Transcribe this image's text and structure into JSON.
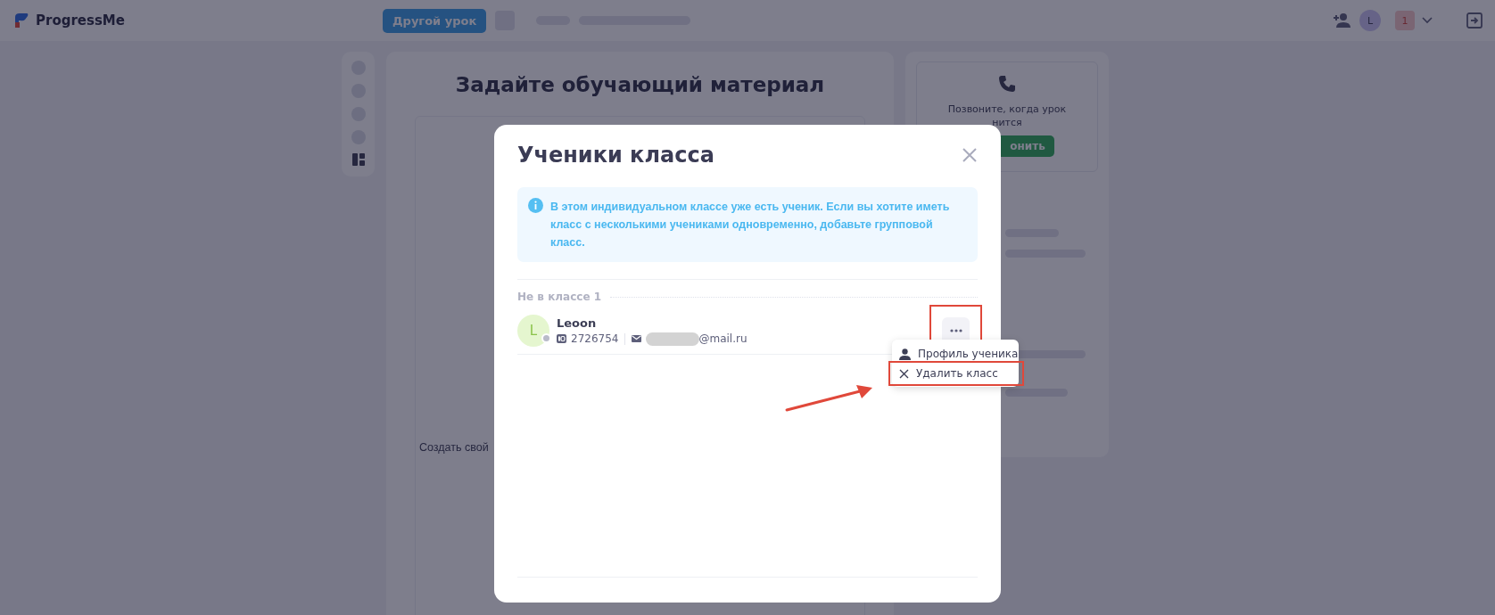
{
  "top_bar": {
    "logo": "ProgressMe",
    "lesson_button": "Другой урок",
    "avatar_initial": "L",
    "notification_count": "1"
  },
  "page": {
    "heading": "Задайте обучающий материал",
    "create_own": "Создать свой",
    "call_card": {
      "text_line_1": "Позвоните, когда урок",
      "text_line_2": "нится",
      "button": "онить"
    }
  },
  "modal": {
    "title": "Ученики класса",
    "info": "В этом индивидуальном классе уже есть ученик. Если вы хотите иметь класс с несколькими учениками одновременно, добавьте групповой класс.",
    "section": "Не в классе 1",
    "students": [
      {
        "initial": "L",
        "name": "Leoon",
        "id": "2726754",
        "email_visible": "@mail.ru",
        "menu_highlighted": true
      }
    ],
    "menu": [
      {
        "label": "Профиль ученика",
        "kind": "profile",
        "highlighted": false
      },
      {
        "label": "Удалить класс",
        "kind": "delete",
        "highlighted": true
      }
    ]
  }
}
